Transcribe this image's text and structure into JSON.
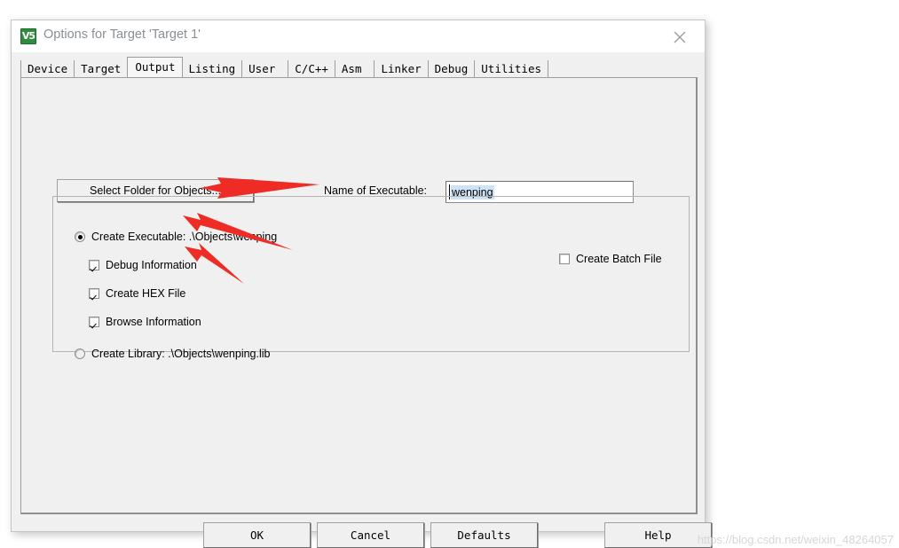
{
  "window": {
    "title": "Options for Target 'Target 1'",
    "icon": "keil-uvision-icon",
    "icon_glyph": "V5",
    "close_icon": "close-icon"
  },
  "tabs": [
    {
      "label": "Device",
      "active": false
    },
    {
      "label": "Target",
      "active": false
    },
    {
      "label": "Output",
      "active": true
    },
    {
      "label": "Listing",
      "active": false
    },
    {
      "label": "User",
      "active": false
    },
    {
      "label": "C/C++",
      "active": false
    },
    {
      "label": "Asm",
      "active": false
    },
    {
      "label": "Linker",
      "active": false
    },
    {
      "label": "Debug",
      "active": false
    },
    {
      "label": "Utilities",
      "active": false
    }
  ],
  "output": {
    "select_folder_label": "Select Folder for Objects...",
    "executable_label": "Name of Executable:",
    "executable_value": "wenping",
    "executable_placeholder": "",
    "create_executable": {
      "label": "Create Executable:  .\\Objects\\wenping",
      "selected": true
    },
    "create_library": {
      "label": "Create Library:  .\\Objects\\wenping.lib",
      "selected": false
    },
    "debug_information": {
      "label": "Debug Information",
      "checked": true
    },
    "create_hex_file": {
      "label": "Create HEX File",
      "checked": true
    },
    "browse_information": {
      "label": "Browse Information",
      "checked": true
    },
    "create_batch_file": {
      "label": "Create Batch File",
      "checked": false
    }
  },
  "buttons": {
    "ok": "OK",
    "cancel": "Cancel",
    "defaults": "Defaults",
    "help": "Help"
  },
  "annotations": {
    "arrow_color": "#ee2b24",
    "arrows": [
      {
        "name": "arrow-to-debug-information",
        "points_at": "Debug Information"
      },
      {
        "name": "arrow-to-create-hex-file",
        "points_at": "Create HEX File"
      },
      {
        "name": "arrow-to-browse-information",
        "points_at": "Browse Information"
      }
    ]
  },
  "watermark": {
    "text": "https://blog.csdn.net/weixin_48264057"
  }
}
